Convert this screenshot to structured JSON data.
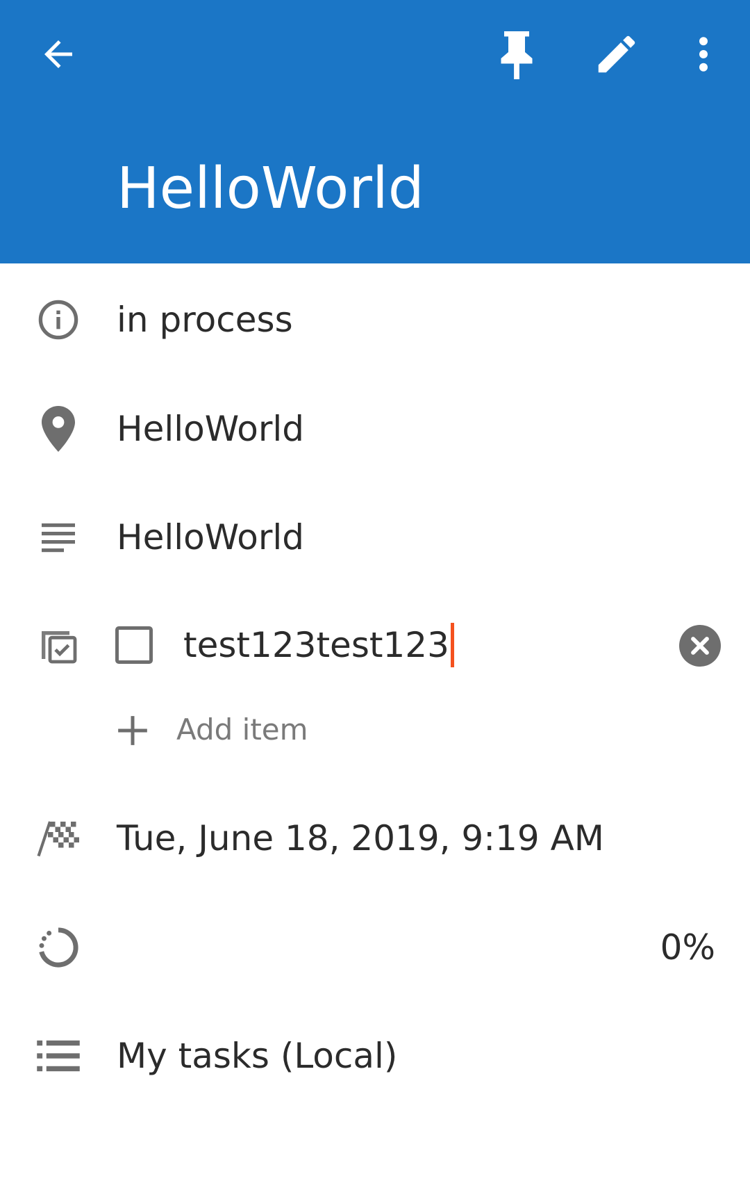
{
  "colors": {
    "appbar": "#1b76c6",
    "on_appbar": "#ffffff",
    "icon_gray": "#6e6e6e",
    "text": "#2b2b2b",
    "caret": "#f4511e"
  },
  "appbar": {
    "icons": {
      "back": "arrow-back-icon",
      "pin": "pin-icon",
      "edit": "pencil-icon",
      "more": "more-vert-icon"
    },
    "title": "HelloWorld"
  },
  "details": {
    "status": {
      "icon": "info-icon",
      "text": "in process"
    },
    "location": {
      "icon": "location-pin-icon",
      "text": "HelloWorld"
    },
    "description": {
      "icon": "notes-icon",
      "text": "HelloWorld"
    },
    "checklist": {
      "icon": "checklist-icon",
      "item_text": "test123test123",
      "checked": false,
      "clear_icon": "clear-circle-icon",
      "add_label": "Add item",
      "add_icon": "plus-icon"
    },
    "due": {
      "icon": "checkered-flag-icon",
      "text": "Tue, June 18, 2019, 9:19 AM"
    },
    "progress": {
      "icon": "progress-ring-icon",
      "percent_text": "0%",
      "value": 0
    },
    "list": {
      "icon": "list-icon",
      "text": "My tasks (Local)"
    }
  }
}
